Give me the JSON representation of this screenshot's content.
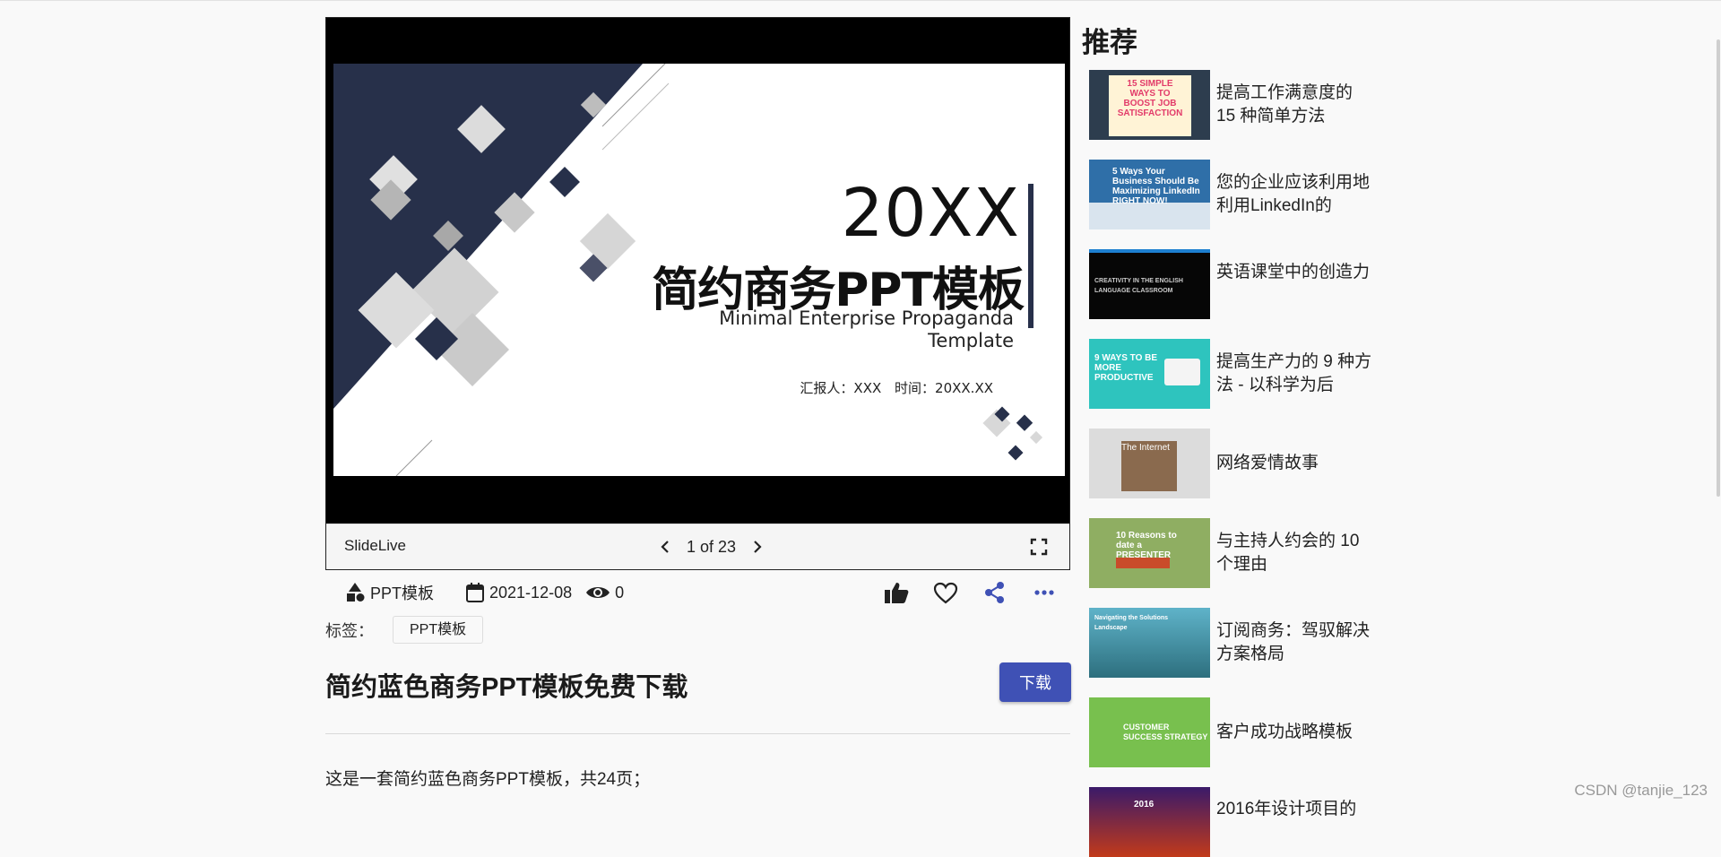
{
  "viewer": {
    "slide": {
      "year": "20XX",
      "title": "简约商务PPT模板",
      "subtitle": "Minimal Enterprise Propaganda Template",
      "reporter": "汇报人：XXX",
      "time": "时间：20XX.XX",
      "colors": {
        "navy": "#27304a",
        "gray": "#cfcfcf"
      }
    },
    "brand": "SlideLive",
    "page_indicator": "1 of 23",
    "icons": {
      "prev": "chevron-left-icon",
      "next": "chevron-right-icon",
      "fullscreen": "fullscreen-icon"
    }
  },
  "meta": {
    "category": "PPT模板",
    "date": "2021-12-08",
    "views": "0"
  },
  "actions": [
    "like-icon",
    "favorite-icon",
    "share-icon",
    "more-icon"
  ],
  "tags": {
    "label": "标签：",
    "items": [
      "PPT模板"
    ]
  },
  "document": {
    "title": "简约蓝色商务PPT模板免费下载",
    "download_label": "下载",
    "description": "这是一套简约蓝色商务PPT模板，共24页；"
  },
  "sidebar": {
    "heading": "推荐",
    "items": [
      {
        "title": "提高工作满意度的 15 种简单方法",
        "thumb_text": "15 SIMPLE WAYS TO BOOST JOB SATISFACTION",
        "bg": "#2d3d4e"
      },
      {
        "title": "您的企业应该利用地利用LinkedIn的",
        "thumb_text": "5 Ways Your Business Should Be Maximizing LinkedIn RIGHT NOW!",
        "bg": "#2f6fa8"
      },
      {
        "title": "英语课堂中的创造力",
        "thumb_text": "CREATIVITY IN THE ENGLISH LANGUAGE CLASSROOM",
        "bg": "#060606"
      },
      {
        "title": "提高生产力的 9 种方法 - 以科学为后",
        "thumb_text": "9 WAYS TO BE MORE PRODUCTIVE",
        "bg": "#2ec4be"
      },
      {
        "title": "网络爱情故事",
        "thumb_text": "The Internet",
        "bg": "#dcdcdc"
      },
      {
        "title": "与主持人约会的 10 个理由",
        "thumb_text": "10 Reasons to date a PRESENTER",
        "bg": "#8fae62"
      },
      {
        "title": "订阅商务：驾驭解决方案格局",
        "thumb_text": "Navigating the Solutions Landscape",
        "bg": "#3f8fa6"
      },
      {
        "title": "客户成功战略模板",
        "thumb_text": "CUSTOMER SUCCESS STRATEGY",
        "bg": "#78c04e"
      },
      {
        "title": "2016年设计项目的",
        "thumb_text": "2016",
        "bg": "#7a2016"
      }
    ]
  },
  "watermark": "CSDN @tanjie_123"
}
